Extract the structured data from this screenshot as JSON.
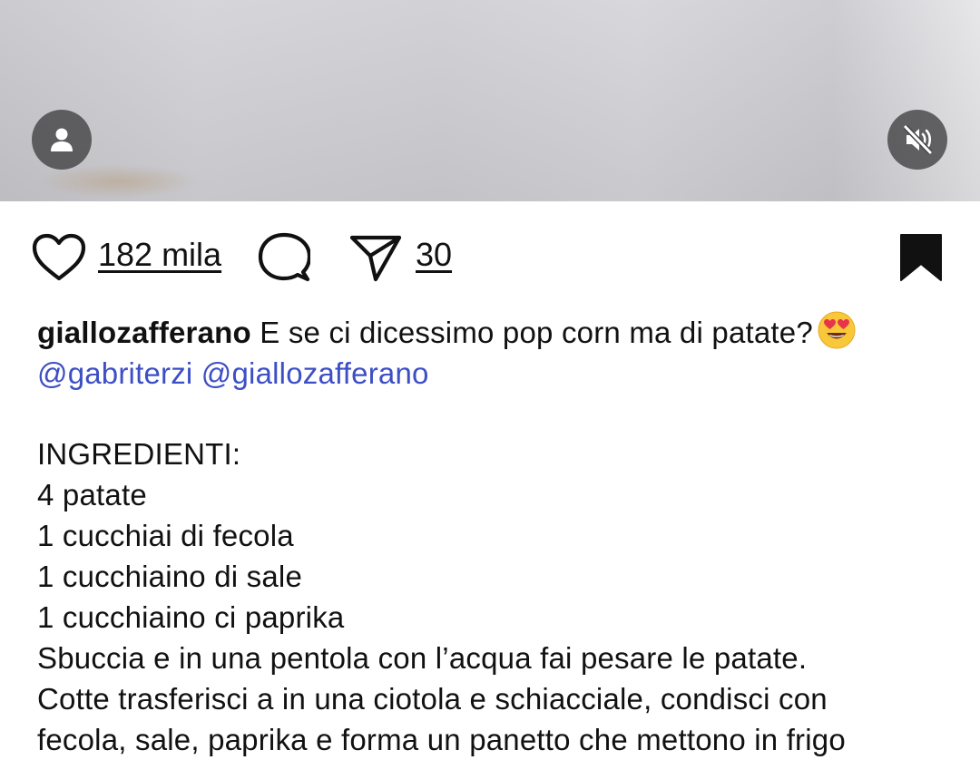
{
  "post": {
    "like_count": "182 mila",
    "share_count": "30",
    "username": "giallozafferano",
    "caption_text": "E se ci dicessimo pop corn ma di patate?",
    "caption_emoji": "heart-eyes-emoji",
    "mentions": [
      "@gabriterzi",
      "@giallozafferano"
    ],
    "ingredients_heading": "INGREDIENTI:",
    "ingredients": [
      "4 patate",
      "1 cucchiai di fecola",
      "1 cucchiaino di sale",
      "1 cucchiaino ci paprika"
    ],
    "body_lines": [
      "Sbuccia e in una pentola con l’acqua fai pesare le patate.",
      "Cotte trasferisci a in una ciotola e schiacciale, condisci con",
      "fecola, sale, paprika e forma un panetto che mettono in frigo"
    ]
  },
  "icons": {
    "user": "user-icon",
    "mute": "speaker-muted-icon",
    "like": "heart-icon",
    "comment": "comment-bubble-icon",
    "share": "paper-plane-icon",
    "save": "bookmark-icon"
  },
  "colors": {
    "mention": "#3d4fc5",
    "overlay_button": "#464648"
  }
}
